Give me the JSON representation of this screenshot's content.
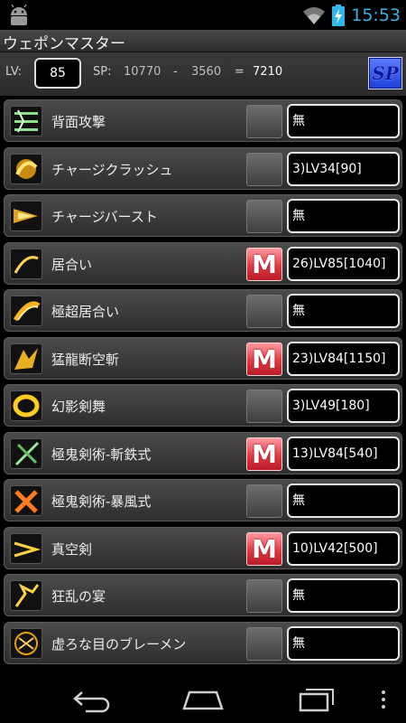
{
  "status_bar": {
    "time": "15:53",
    "icons": [
      "android-icon",
      "wifi-icon",
      "battery-charging-icon"
    ]
  },
  "app": {
    "title": "ウェポンマスター"
  },
  "level_bar": {
    "lv_label": "LV:",
    "lv_value": "85",
    "sp_label": "SP:",
    "sp_total": "10770",
    "minus": "-",
    "sp_used": "3560",
    "equals": "=",
    "sp_remaining": "7210",
    "sp_button_label": "SP"
  },
  "colors": {
    "accent_blue": "#33b5e5",
    "master_red": "#e23a45",
    "sp_button_blue": "#1d3fd9"
  },
  "skills": [
    {
      "name": "背面攻撃",
      "master": false,
      "value": "無",
      "icon": "back-attack-icon"
    },
    {
      "name": "チャージクラッシュ",
      "master": false,
      "value": "3)LV34[90]",
      "icon": "charge-crash-icon"
    },
    {
      "name": "チャージバースト",
      "master": false,
      "value": "無",
      "icon": "charge-burst-icon"
    },
    {
      "name": "居合い",
      "master": true,
      "value": "26)LV85[1040]",
      "icon": "iai-icon"
    },
    {
      "name": "極超居合い",
      "master": false,
      "value": "無",
      "icon": "super-iai-icon"
    },
    {
      "name": "猛龍断空斬",
      "master": true,
      "value": "23)LV84[1150]",
      "icon": "dragon-slash-icon"
    },
    {
      "name": "幻影剣舞",
      "master": false,
      "value": "3)LV49[180]",
      "icon": "phantom-dance-icon"
    },
    {
      "name": "極鬼剣術-斬鉄式",
      "master": true,
      "value": "13)LV84[540]",
      "icon": "demon-sword-steel-icon"
    },
    {
      "name": "極鬼剣術-暴風式",
      "master": false,
      "value": "無",
      "icon": "demon-sword-storm-icon"
    },
    {
      "name": "真空剣",
      "master": true,
      "value": "10)LV42[500]",
      "icon": "vacuum-sword-icon"
    },
    {
      "name": "狂乱の宴",
      "master": false,
      "value": "無",
      "icon": "frenzy-feast-icon"
    },
    {
      "name": "虚ろな目のブレーメン",
      "master": false,
      "value": "無",
      "icon": "hollow-eyes-icon"
    }
  ],
  "master_button_label": "M",
  "nav": {
    "buttons": [
      "back-icon",
      "home-icon",
      "recent-apps-icon"
    ],
    "overflow": "menu-overflow-icon"
  }
}
